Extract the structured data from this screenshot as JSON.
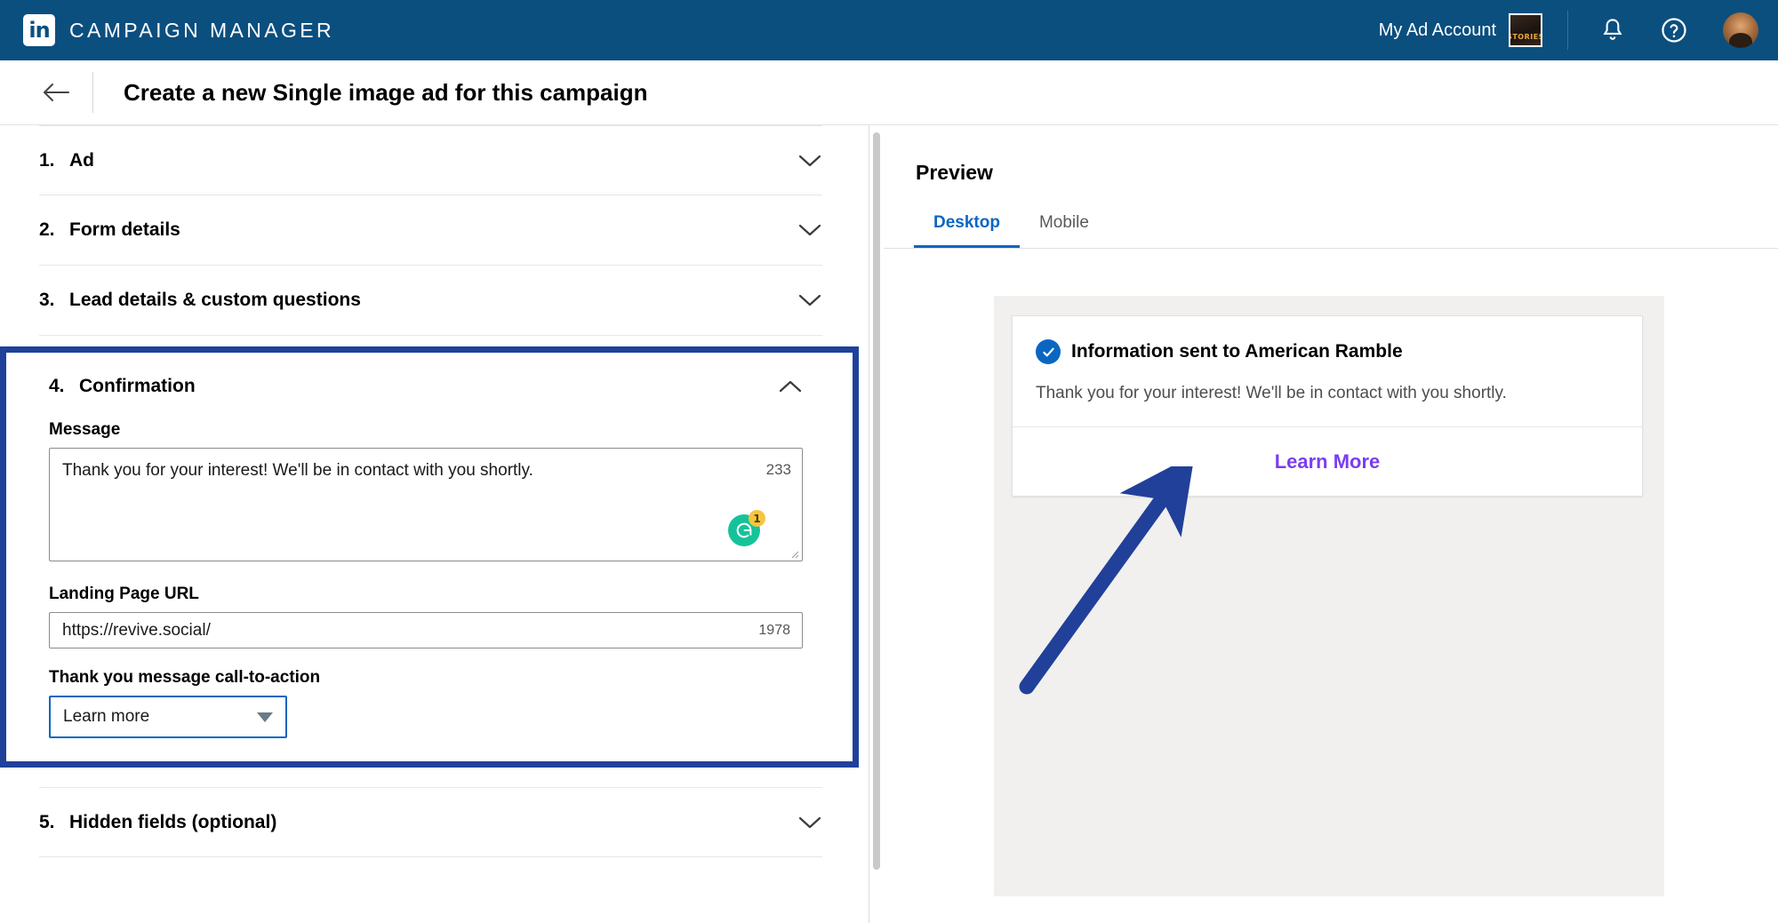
{
  "topbar": {
    "brand_logo_text": "in",
    "brand_title": "CAMPAIGN MANAGER",
    "account_name": "My Ad Account",
    "account_thumb_label": "STORIES",
    "icons": [
      "bell-icon",
      "help-icon",
      "avatar"
    ]
  },
  "page": {
    "back_label": "back-arrow",
    "title": "Create a new Single image ad for this campaign"
  },
  "sections": [
    {
      "num": "1.",
      "label": "Ad",
      "expanded": false
    },
    {
      "num": "2.",
      "label": "Form details",
      "expanded": false
    },
    {
      "num": "3.",
      "label": "Lead details & custom questions",
      "expanded": false
    },
    {
      "num": "4.",
      "label": "Confirmation",
      "expanded": true
    },
    {
      "num": "5.",
      "label": "Hidden fields (optional)",
      "expanded": false
    }
  ],
  "confirmation": {
    "num": "4.",
    "title": "Confirmation",
    "message_label": "Message",
    "message_value": "Thank you for your interest! We'll be in contact with you shortly.",
    "message_counter": "233",
    "grammarly_badge": "1",
    "url_label": "Landing Page URL",
    "url_value": "https://revive.social/",
    "url_counter": "1978",
    "cta_label": "Thank you message call-to-action",
    "cta_value": "Learn more",
    "cta_options": [
      "Learn more"
    ]
  },
  "preview": {
    "title": "Preview",
    "tabs": [
      {
        "label": "Desktop",
        "active": true
      },
      {
        "label": "Mobile",
        "active": false
      }
    ],
    "card": {
      "heading": "Information sent to American Ramble",
      "body": "Thank you for your interest! We'll be in contact with you shortly.",
      "cta": "Learn More"
    }
  },
  "colors": {
    "nav_blue": "#0b4f7f",
    "highlight_blue": "#20419a",
    "link_blue": "#0a66c2",
    "cta_purple": "#7a3df0",
    "grammarly_green": "#15c39a",
    "badge_orange": "#f5c542"
  }
}
